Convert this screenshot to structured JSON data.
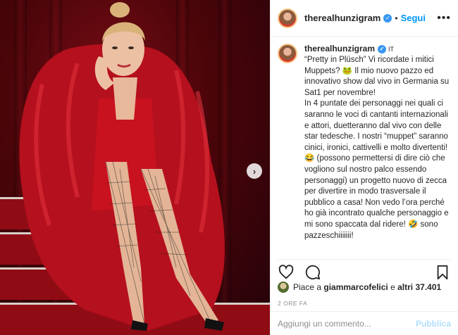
{
  "post": {
    "username": "therealhunzigram",
    "dot": "•",
    "follow_label": "Segui",
    "more_label": "•••",
    "language_badge": "IT",
    "caption": "“Pretty in Plüsch” Vi ricordate i mitici Muppets? 🐸 Il mio nuovo pazzo ed innovativo show dal vivo in Germania su Sat1 per novembre!\nIn 4 puntate dei personaggi nei quali ci saranno le voci di cantanti internazionali e attori, duetteranno dal vivo con delle star tedesche. I nostri “muppet” saranno cinici, ironici, cattivelli e molto divertenti! 😂 (possono permettersi di dire ciò che vogliono sul nostro palco essendo personaggi) un progetto nuovo di zecca per divertire in modo trasversale il pubblico a casa! Non vedo l’ora perché ho già incontrato qualche personaggio e mi sono spaccata dal ridere! 🤣 sono pazzeschiiiiiii!",
    "likes_prefix": "Piace a",
    "likes_user": "giammarcofelici",
    "likes_conj": "e",
    "likes_count": "altri 37.401",
    "time_ago": "2 ORE FA",
    "comment_placeholder": "Aggiungi un commento...",
    "publish_label": "Pubblica"
  },
  "icons": {
    "verified": "verified-badge-icon",
    "like": "heart-icon",
    "comment": "comment-bubble-icon",
    "save": "bookmark-icon",
    "next": "chevron-right-icon"
  },
  "colors": {
    "accent": "#0095f6",
    "verified": "#3897f0",
    "publish_disabled": "#b2dffc",
    "photo_background": "#4a0509"
  }
}
